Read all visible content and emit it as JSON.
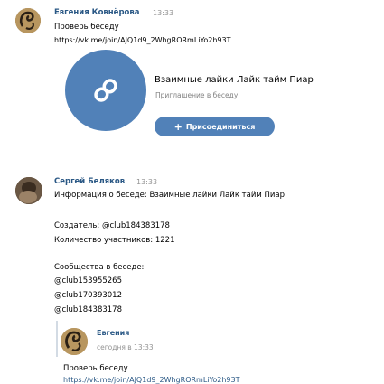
{
  "message1": {
    "author": "Евгения Ковнёрова",
    "time": "13:33",
    "text": "Проверь беседу",
    "link": "https://vk.me/join/AJQ1d9_2WhgRORmLiYo2h93T"
  },
  "card": {
    "title": "Взаимные лайки Лайк тайм Пиар",
    "subtitle": "Приглашение в беседу",
    "join_label": "Присоединиться",
    "icon": "link-icon"
  },
  "message2": {
    "author": "Сергей Беляков",
    "time": "13:33",
    "info": "Информация о беседе: Взаимные лайки Лайк тайм Пиар",
    "creator_label": "Создатель:",
    "creator_value": "@club184383178",
    "members": "Количество участников: 1221",
    "communities_title": "Сообщества в беседе:",
    "communities": [
      "@club153955265",
      "@club170393012",
      "@club184383178"
    ]
  },
  "forwarded": {
    "author": "Евгения",
    "time": "сегодня в 13:33",
    "text": "Проверь беседу",
    "link_partial": "https://vk.me/join/AJQ1d9_2WhgRORmLiYo2h93T"
  },
  "colors": {
    "accent": "#5181b8",
    "link": "#2a5885",
    "secondary": "#939393"
  }
}
